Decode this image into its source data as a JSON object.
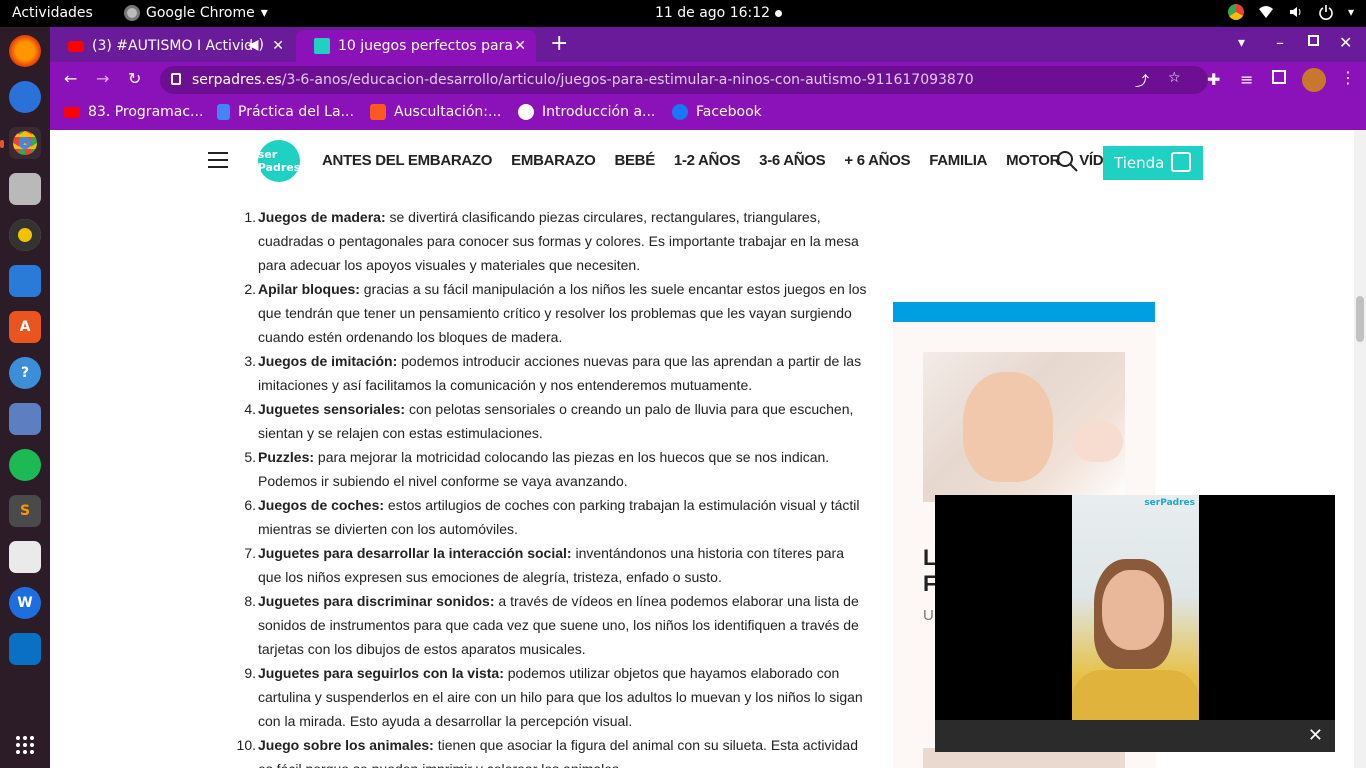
{
  "topbar": {
    "activities": "Actividades",
    "app_name": "Google Chrome",
    "clock": "11 de ago  16:12"
  },
  "tabs": [
    {
      "title": "(3) #AUTISMO I Activid",
      "favicon": "youtube-icon",
      "audio": true
    },
    {
      "title": "10 juegos perfectos para e",
      "favicon": "serpadres-icon",
      "active": true
    }
  ],
  "omnibox": {
    "host": "serpadres.es",
    "path": "/3-6-anos/educacion-desarrollo/articulo/juegos-para-estimular-a-ninos-con-autismo-911617093870"
  },
  "bookmarks": [
    {
      "label": "83. Programac...",
      "icon": "youtube-icon",
      "color": "#ff0000"
    },
    {
      "label": "Práctica del La...",
      "icon": "docs-icon",
      "color": "#4285f4"
    },
    {
      "label": "Auscultación:...",
      "icon": "page-icon",
      "color": "#ff5722"
    },
    {
      "label": "Introducción a...",
      "icon": "globe-icon",
      "color": "#ffffff"
    },
    {
      "label": "Facebook",
      "icon": "facebook-icon",
      "color": "#1877f2"
    }
  ],
  "site": {
    "logo": "ser Padres",
    "nav": [
      "ANTES DEL EMBARAZO",
      "EMBARAZO",
      "BEBÉ",
      "1-2 AÑOS",
      "3-6 AÑOS",
      "+ 6 AÑOS",
      "FAMILIA",
      "MOTOR",
      "VÍDEOS"
    ],
    "shop": "Tienda",
    "brand_color": "#1fd1c3"
  },
  "article": {
    "items": [
      {
        "num": "1.",
        "title": "Juegos de madera:",
        "text": " se divertirá clasificando piezas circulares, rectangulares, triangulares, cuadradas o pentagonales para conocer sus formas y colores. Es importante trabajar en la mesa para adecuar los apoyos visuales y materiales que necesiten."
      },
      {
        "num": "2.",
        "title": "Apilar bloques:",
        "text": " gracias a su fácil manipulación a los niños les suele encantar estos juegos en los que tendrán que tener un pensamiento crítico y resolver los problemas que les vayan surgiendo cuando estén ordenando los bloques de madera."
      },
      {
        "num": "3.",
        "title": "Juegos de imitación:",
        "text": " podemos introducir acciones nuevas para que las aprendan a partir de las imitaciones y así facilitamos la comunicación y nos entenderemos mutuamente."
      },
      {
        "num": "4.",
        "title": "Juguetes sensoriales:",
        "text": " con pelotas sensoriales o creando un palo de lluvia para que escuchen, sientan y se relajen con estas estimulaciones."
      },
      {
        "num": "5.",
        "title": "Puzzles:",
        "text": " para mejorar la motricidad colocando las piezas en los huecos que se nos indican. Podemos ir subiendo el nivel conforme se vaya avanzando."
      },
      {
        "num": "6.",
        "title": "Juegos de coches:",
        "text": " estos artilugios de coches con parking trabajan la estimulación visual y táctil mientras se divierten con los automóviles."
      },
      {
        "num": "7.",
        "title": "Juguetes para desarrollar la interacción social:",
        "text": " inventándonos una historia con títeres para que los niños expresen sus emociones de alegría, tristeza, enfado o susto."
      },
      {
        "num": "8.",
        "title": "Juguetes para discriminar sonidos:",
        "text": " a través de vídeos en línea podemos elaborar una lista de sonidos de instrumentos para que cada vez que suene uno, los niños los identifiquen a través de tarjetas con los dibujos de estos aparatos musicales."
      },
      {
        "num": "9.",
        "title": "Juguetes para seguirlos con la vista:",
        "text": "  podemos utilizar objetos que hayamos elaborado con cartulina y suspenderlos en el aire con un hilo para que los adultos lo muevan y los niños lo sigan con la mirada. Esto ayuda a desarrollar la percepción visual."
      },
      {
        "num": "10.",
        "title": "Juego sobre los animales:",
        "text": " tienen que asociar la figura del animal con su silueta. Esta actividad es fácil porque se pueden imprimir y colorear los animales."
      }
    ]
  },
  "sidebar": {
    "band_color": "#009fe3",
    "card_text_1": "L",
    "card_text_2": "F",
    "card_text_3": "U"
  },
  "video": {
    "brand": "serPadres"
  }
}
